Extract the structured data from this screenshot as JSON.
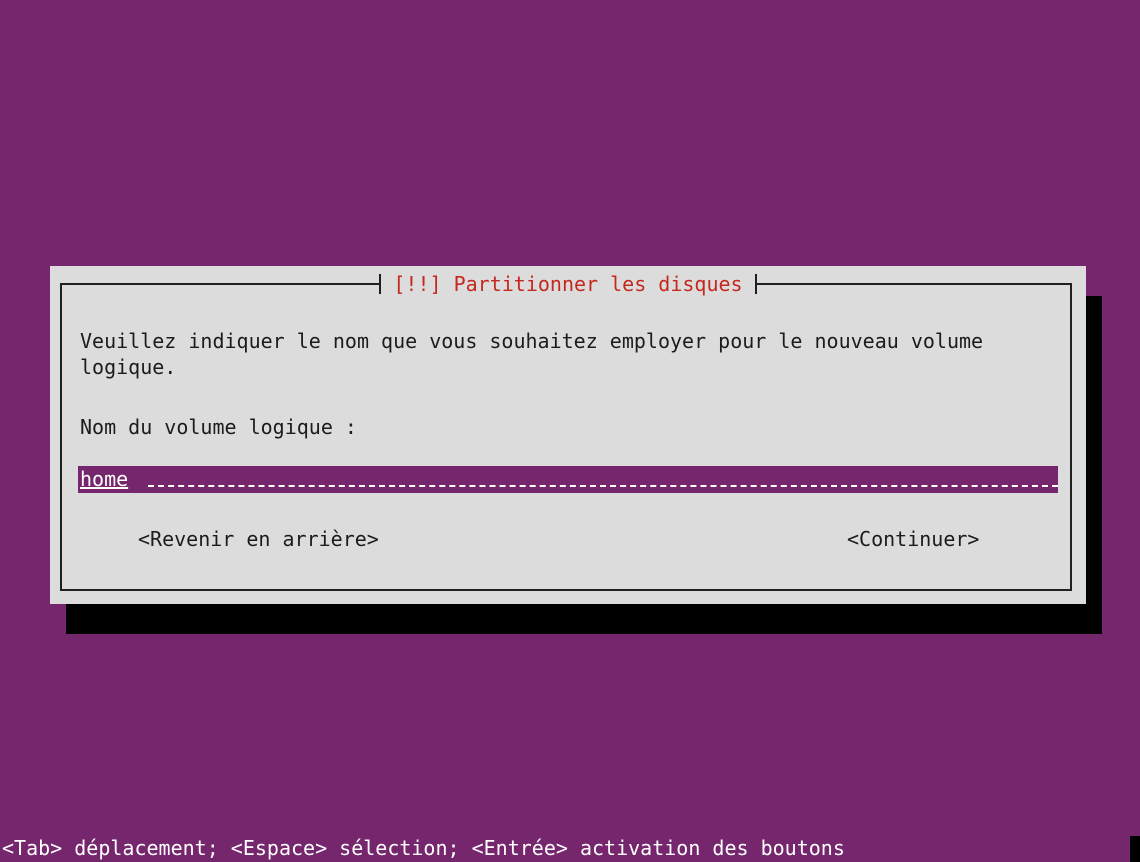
{
  "dialog": {
    "title": "[!!] Partitionner les disques",
    "prompt": "Veuillez indiquer le nom que vous souhaitez employer pour le nouveau volume logique.",
    "field_label": "Nom du volume logique :",
    "input_value": "home",
    "back_button": "<Revenir en arrière>",
    "continue_button": "<Continuer>"
  },
  "statusbar": {
    "help_text": "<Tab> déplacement; <Espace> sélection; <Entrée> activation des boutons"
  },
  "colors": {
    "background": "#75266d",
    "dialog_bg": "#dcdcdc",
    "title": "#c4281e",
    "shadow": "#000000"
  }
}
